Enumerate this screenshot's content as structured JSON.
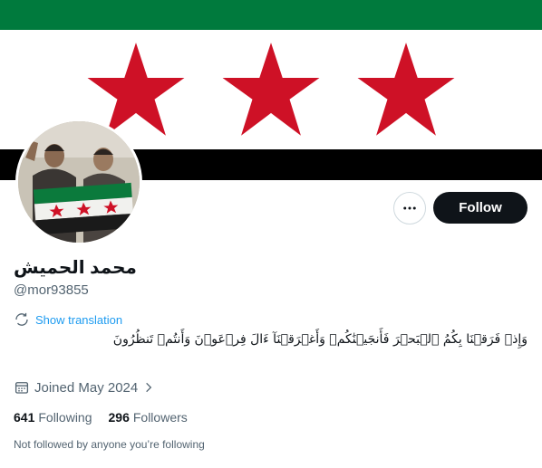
{
  "profile": {
    "display_name": "محمد الحميش",
    "handle": "@mor93855",
    "bio": "وَإِذۡ فَرَقۡنَا بِكُمُ ٱلۡبَحۡرَ فَأَنجَيۡنَٰكُمۡ وَأَغۡرَقۡنَآ ءَالَ فِرۡعَوۡنَ وَأَنتُمۡ تَنظُرُونَ",
    "show_translation": "Show translation",
    "joined": "Joined May 2024",
    "following_count": "641",
    "following_label": "Following",
    "followers_count": "296",
    "followers_label": "Followers",
    "not_followed": "Not followed by anyone you’re following"
  },
  "actions": {
    "follow_label": "Follow"
  },
  "banner": {
    "colors": {
      "green": "#007a3d",
      "white": "#ffffff",
      "black": "#000000",
      "star": "#ce1126"
    }
  },
  "icons": [
    "more-icon",
    "translate-icon",
    "calendar-icon",
    "chevron-right-icon"
  ],
  "colors": {
    "accent": "#1d9bf0",
    "text": "#0f1419",
    "muted": "#536471",
    "border": "#cfd9de"
  }
}
